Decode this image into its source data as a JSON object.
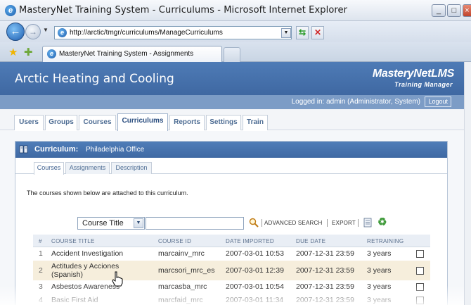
{
  "window": {
    "title": "MasteryNet Training System - Curriculums - Microsoft Internet Explorer"
  },
  "browser": {
    "url": "http://arctic/tmgr/curriculums/ManageCurriculums",
    "tab_title": "MasteryNet Training System - Assignments"
  },
  "app": {
    "company": "Arctic Heating and Cooling",
    "brand_line1": "MasteryNetLMS",
    "brand_line2": "Training Manager",
    "logged_in_text": "Logged in: admin (Administrator, System)",
    "logout_label": "Logout"
  },
  "main_tabs": [
    {
      "label": "Users"
    },
    {
      "label": "Groups"
    },
    {
      "label": "Courses"
    },
    {
      "label": "Curriculums",
      "active": true
    },
    {
      "label": "Reports"
    },
    {
      "label": "Settings"
    },
    {
      "label": "Train"
    }
  ],
  "panel": {
    "label": "Curriculum:",
    "value": "Philadelphia Office",
    "sub_tabs": [
      {
        "label": "Courses",
        "active": true
      },
      {
        "label": "Assignments"
      },
      {
        "label": "Description"
      }
    ],
    "intro": "The courses shown below are attached to this curriculum."
  },
  "toolbar": {
    "field_select": "Course Title",
    "search_value": "",
    "advanced_search": "ADVANCED SEARCH",
    "export": "EXPORT"
  },
  "grid": {
    "headers": [
      "#",
      "COURSE TITLE",
      "COURSE ID",
      "DATE IMPORTED",
      "DUE DATE",
      "RETRAINING"
    ],
    "rows": [
      {
        "num": "1",
        "title": "Accident Investigation",
        "title2": "",
        "id": "marcainv_mrc",
        "imported": "2007-03-01 10:53",
        "due": "2007-12-31 23:59",
        "retraining": "3 years"
      },
      {
        "num": "2",
        "title": "Actitudes y Acciones",
        "title2": "(Spanish)",
        "id": "marcsori_mrc_es",
        "imported": "2007-03-01 12:39",
        "due": "2007-12-31 23:59",
        "retraining": "3 years"
      },
      {
        "num": "3",
        "title": "Asbestos Awareness",
        "title2": "",
        "id": "marcasba_mrc",
        "imported": "2007-03-01 10:54",
        "due": "2007-12-31 23:59",
        "retraining": "3 years"
      },
      {
        "num": "4",
        "title": "Basic First Aid",
        "title2": "",
        "id": "marcfaid_mrc",
        "imported": "2007-03-01 11:34",
        "due": "2007-12-31 23:59",
        "retraining": "3 years"
      }
    ]
  }
}
